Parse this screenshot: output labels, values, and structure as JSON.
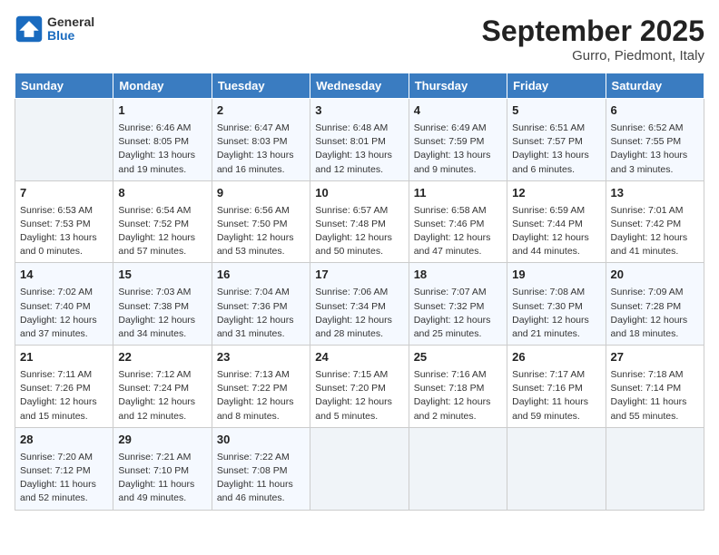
{
  "header": {
    "logo_general": "General",
    "logo_blue": "Blue",
    "title": "September 2025",
    "subtitle": "Gurro, Piedmont, Italy"
  },
  "days_of_week": [
    "Sunday",
    "Monday",
    "Tuesday",
    "Wednesday",
    "Thursday",
    "Friday",
    "Saturday"
  ],
  "weeks": [
    [
      {
        "day": "",
        "sunrise": "",
        "sunset": "",
        "daylight": ""
      },
      {
        "day": "1",
        "sunrise": "Sunrise: 6:46 AM",
        "sunset": "Sunset: 8:05 PM",
        "daylight": "Daylight: 13 hours and 19 minutes."
      },
      {
        "day": "2",
        "sunrise": "Sunrise: 6:47 AM",
        "sunset": "Sunset: 8:03 PM",
        "daylight": "Daylight: 13 hours and 16 minutes."
      },
      {
        "day": "3",
        "sunrise": "Sunrise: 6:48 AM",
        "sunset": "Sunset: 8:01 PM",
        "daylight": "Daylight: 13 hours and 12 minutes."
      },
      {
        "day": "4",
        "sunrise": "Sunrise: 6:49 AM",
        "sunset": "Sunset: 7:59 PM",
        "daylight": "Daylight: 13 hours and 9 minutes."
      },
      {
        "day": "5",
        "sunrise": "Sunrise: 6:51 AM",
        "sunset": "Sunset: 7:57 PM",
        "daylight": "Daylight: 13 hours and 6 minutes."
      },
      {
        "day": "6",
        "sunrise": "Sunrise: 6:52 AM",
        "sunset": "Sunset: 7:55 PM",
        "daylight": "Daylight: 13 hours and 3 minutes."
      }
    ],
    [
      {
        "day": "7",
        "sunrise": "Sunrise: 6:53 AM",
        "sunset": "Sunset: 7:53 PM",
        "daylight": "Daylight: 13 hours and 0 minutes."
      },
      {
        "day": "8",
        "sunrise": "Sunrise: 6:54 AM",
        "sunset": "Sunset: 7:52 PM",
        "daylight": "Daylight: 12 hours and 57 minutes."
      },
      {
        "day": "9",
        "sunrise": "Sunrise: 6:56 AM",
        "sunset": "Sunset: 7:50 PM",
        "daylight": "Daylight: 12 hours and 53 minutes."
      },
      {
        "day": "10",
        "sunrise": "Sunrise: 6:57 AM",
        "sunset": "Sunset: 7:48 PM",
        "daylight": "Daylight: 12 hours and 50 minutes."
      },
      {
        "day": "11",
        "sunrise": "Sunrise: 6:58 AM",
        "sunset": "Sunset: 7:46 PM",
        "daylight": "Daylight: 12 hours and 47 minutes."
      },
      {
        "day": "12",
        "sunrise": "Sunrise: 6:59 AM",
        "sunset": "Sunset: 7:44 PM",
        "daylight": "Daylight: 12 hours and 44 minutes."
      },
      {
        "day": "13",
        "sunrise": "Sunrise: 7:01 AM",
        "sunset": "Sunset: 7:42 PM",
        "daylight": "Daylight: 12 hours and 41 minutes."
      }
    ],
    [
      {
        "day": "14",
        "sunrise": "Sunrise: 7:02 AM",
        "sunset": "Sunset: 7:40 PM",
        "daylight": "Daylight: 12 hours and 37 minutes."
      },
      {
        "day": "15",
        "sunrise": "Sunrise: 7:03 AM",
        "sunset": "Sunset: 7:38 PM",
        "daylight": "Daylight: 12 hours and 34 minutes."
      },
      {
        "day": "16",
        "sunrise": "Sunrise: 7:04 AM",
        "sunset": "Sunset: 7:36 PM",
        "daylight": "Daylight: 12 hours and 31 minutes."
      },
      {
        "day": "17",
        "sunrise": "Sunrise: 7:06 AM",
        "sunset": "Sunset: 7:34 PM",
        "daylight": "Daylight: 12 hours and 28 minutes."
      },
      {
        "day": "18",
        "sunrise": "Sunrise: 7:07 AM",
        "sunset": "Sunset: 7:32 PM",
        "daylight": "Daylight: 12 hours and 25 minutes."
      },
      {
        "day": "19",
        "sunrise": "Sunrise: 7:08 AM",
        "sunset": "Sunset: 7:30 PM",
        "daylight": "Daylight: 12 hours and 21 minutes."
      },
      {
        "day": "20",
        "sunrise": "Sunrise: 7:09 AM",
        "sunset": "Sunset: 7:28 PM",
        "daylight": "Daylight: 12 hours and 18 minutes."
      }
    ],
    [
      {
        "day": "21",
        "sunrise": "Sunrise: 7:11 AM",
        "sunset": "Sunset: 7:26 PM",
        "daylight": "Daylight: 12 hours and 15 minutes."
      },
      {
        "day": "22",
        "sunrise": "Sunrise: 7:12 AM",
        "sunset": "Sunset: 7:24 PM",
        "daylight": "Daylight: 12 hours and 12 minutes."
      },
      {
        "day": "23",
        "sunrise": "Sunrise: 7:13 AM",
        "sunset": "Sunset: 7:22 PM",
        "daylight": "Daylight: 12 hours and 8 minutes."
      },
      {
        "day": "24",
        "sunrise": "Sunrise: 7:15 AM",
        "sunset": "Sunset: 7:20 PM",
        "daylight": "Daylight: 12 hours and 5 minutes."
      },
      {
        "day": "25",
        "sunrise": "Sunrise: 7:16 AM",
        "sunset": "Sunset: 7:18 PM",
        "daylight": "Daylight: 12 hours and 2 minutes."
      },
      {
        "day": "26",
        "sunrise": "Sunrise: 7:17 AM",
        "sunset": "Sunset: 7:16 PM",
        "daylight": "Daylight: 11 hours and 59 minutes."
      },
      {
        "day": "27",
        "sunrise": "Sunrise: 7:18 AM",
        "sunset": "Sunset: 7:14 PM",
        "daylight": "Daylight: 11 hours and 55 minutes."
      }
    ],
    [
      {
        "day": "28",
        "sunrise": "Sunrise: 7:20 AM",
        "sunset": "Sunset: 7:12 PM",
        "daylight": "Daylight: 11 hours and 52 minutes."
      },
      {
        "day": "29",
        "sunrise": "Sunrise: 7:21 AM",
        "sunset": "Sunset: 7:10 PM",
        "daylight": "Daylight: 11 hours and 49 minutes."
      },
      {
        "day": "30",
        "sunrise": "Sunrise: 7:22 AM",
        "sunset": "Sunset: 7:08 PM",
        "daylight": "Daylight: 11 hours and 46 minutes."
      },
      {
        "day": "",
        "sunrise": "",
        "sunset": "",
        "daylight": ""
      },
      {
        "day": "",
        "sunrise": "",
        "sunset": "",
        "daylight": ""
      },
      {
        "day": "",
        "sunrise": "",
        "sunset": "",
        "daylight": ""
      },
      {
        "day": "",
        "sunrise": "",
        "sunset": "",
        "daylight": ""
      }
    ]
  ]
}
